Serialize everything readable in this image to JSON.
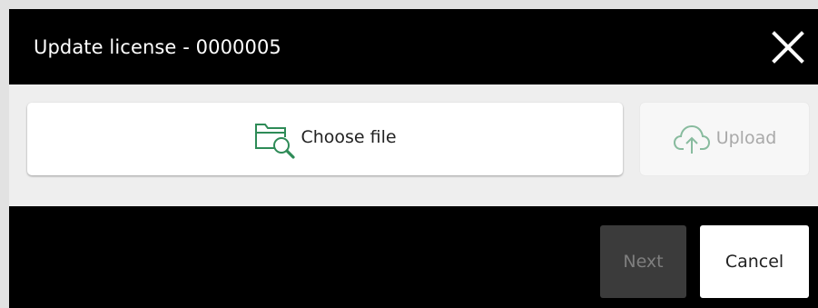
{
  "dialog": {
    "title": "Update license - 0000005",
    "close_icon": "close-icon"
  },
  "file_picker": {
    "choose_label": "Choose file",
    "choose_icon": "folder-search-icon",
    "upload_label": "Upload",
    "upload_icon": "cloud-upload-icon",
    "upload_enabled": false
  },
  "actions": {
    "next_label": "Next",
    "next_enabled": false,
    "cancel_label": "Cancel"
  },
  "colors": {
    "header_bg": "#000000",
    "content_bg": "#eeeeee",
    "accent_green": "#2e8b57",
    "disabled_text": "#a9a9a9"
  }
}
